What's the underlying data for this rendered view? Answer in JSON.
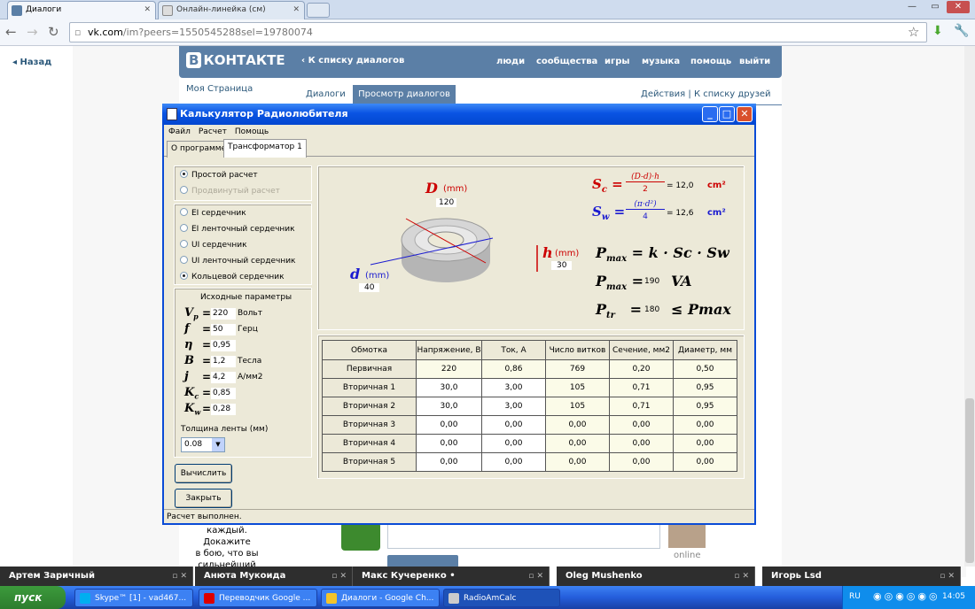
{
  "browser": {
    "tabs": [
      {
        "label": "Диалоги"
      },
      {
        "label": "Онлайн-линейка (см)"
      }
    ],
    "address_host": "vk.com",
    "address_rest": "/im?peers=1550545288sel=19780074",
    "back_label": "Назад"
  },
  "vk": {
    "logo_letter": "В",
    "logo_text": "КОНТАКТЕ",
    "back_to_list": "К списку диалогов",
    "nav": [
      "люди",
      "сообщества",
      "игры",
      "музыка",
      "помощь",
      "выйти"
    ],
    "my_page": "Моя Страница",
    "tab_dialogs": "Диалоги",
    "tab_view": "Просмотр диалогов",
    "actions": "Действия",
    "to_friends": "К списку друзей",
    "side_text_1": "каждый. Докажите",
    "side_text_2": "в бою, что вы",
    "side_text_3": "сильнейший",
    "online": "online"
  },
  "app": {
    "title": "Калькулятор Радиолюбителя",
    "menu": [
      "Файл",
      "Расчет",
      "Помощь"
    ],
    "tabs": [
      "О программе",
      "Трансформатор 1"
    ],
    "calc_mode": {
      "simple": "Простой расчет",
      "advanced": "Продвинутый расчет"
    },
    "cores": [
      "EI сердечник",
      "EI ленточный сердечник",
      "UI сердечник",
      "UI ленточный сердечник",
      "Кольцевой сердечник"
    ],
    "selected_core": 4,
    "params_title": "Исходные параметры",
    "params": [
      {
        "sym": "Vp",
        "val": "220",
        "unit": "Вольт"
      },
      {
        "sym": "f",
        "val": "50",
        "unit": "Герц"
      },
      {
        "sym": "η",
        "val": "0,95",
        "unit": ""
      },
      {
        "sym": "B",
        "val": "1,2",
        "unit": "Тесла"
      },
      {
        "sym": "j",
        "val": "4,2",
        "unit": "А/мм2"
      },
      {
        "sym": "Kc",
        "val": "0,85",
        "unit": ""
      },
      {
        "sym": "Kw",
        "val": "0,28",
        "unit": ""
      }
    ],
    "tape_label": "Толщина ленты (мм)",
    "tape_value": "0.08",
    "btn_calc": "Вычислить",
    "btn_close": "Закрыть",
    "status": "Расчет выполнен.",
    "diagram": {
      "D_label": "D",
      "D_unit": "(mm)",
      "D_value": "120",
      "d_label": "d",
      "d_unit": "(mm)",
      "d_value": "40",
      "h_label": "h",
      "h_unit": "(mm)",
      "h_value": "30"
    },
    "formulas": {
      "sc_num": "(D-d)·h",
      "sc_den": "2",
      "sc_val": "12,0",
      "sc_unit": "cm²",
      "sw_num": "(π·d²)",
      "sw_den": "4",
      "sw_val": "12,6",
      "sw_unit": "cm²",
      "pmax_formula": "= k · Sc · Sw",
      "pmax_val": "190",
      "pmax_unit": "VA",
      "ptr_val": "180",
      "ptr_rel": "≤ Pmax"
    },
    "table": {
      "headers": [
        "Обмотка",
        "Напряжение, В",
        "Ток, А",
        "Число витков",
        "Сечение, мм2",
        "Диаметр, мм"
      ],
      "rows": [
        [
          "Первичная",
          "220",
          "0,86",
          "769",
          "0,20",
          "0,50"
        ],
        [
          "Вторичная 1",
          "30,0",
          "3,00",
          "105",
          "0,71",
          "0,95"
        ],
        [
          "Вторичная 2",
          "30,0",
          "3,00",
          "105",
          "0,71",
          "0,95"
        ],
        [
          "Вторичная 3",
          "0,00",
          "0,00",
          "0,00",
          "0,00",
          "0,00"
        ],
        [
          "Вторичная 4",
          "0,00",
          "0,00",
          "0,00",
          "0,00",
          "0,00"
        ],
        [
          "Вторичная 5",
          "0,00",
          "0,00",
          "0,00",
          "0,00",
          "0,00"
        ]
      ]
    }
  },
  "skype_bars": [
    "Артем Заричный",
    "Анюта Мукоида",
    "Макс Кучеренко •",
    "Oleg Mushenko",
    "Игорь Lsd"
  ],
  "taskbar": {
    "start": "пуск",
    "items": [
      "Skype™ [1] - vad467...",
      "Переводчик Google ...",
      "Диалоги - Google Ch...",
      "RadioAmCalc"
    ],
    "lang": "RU",
    "time": "14:05"
  }
}
